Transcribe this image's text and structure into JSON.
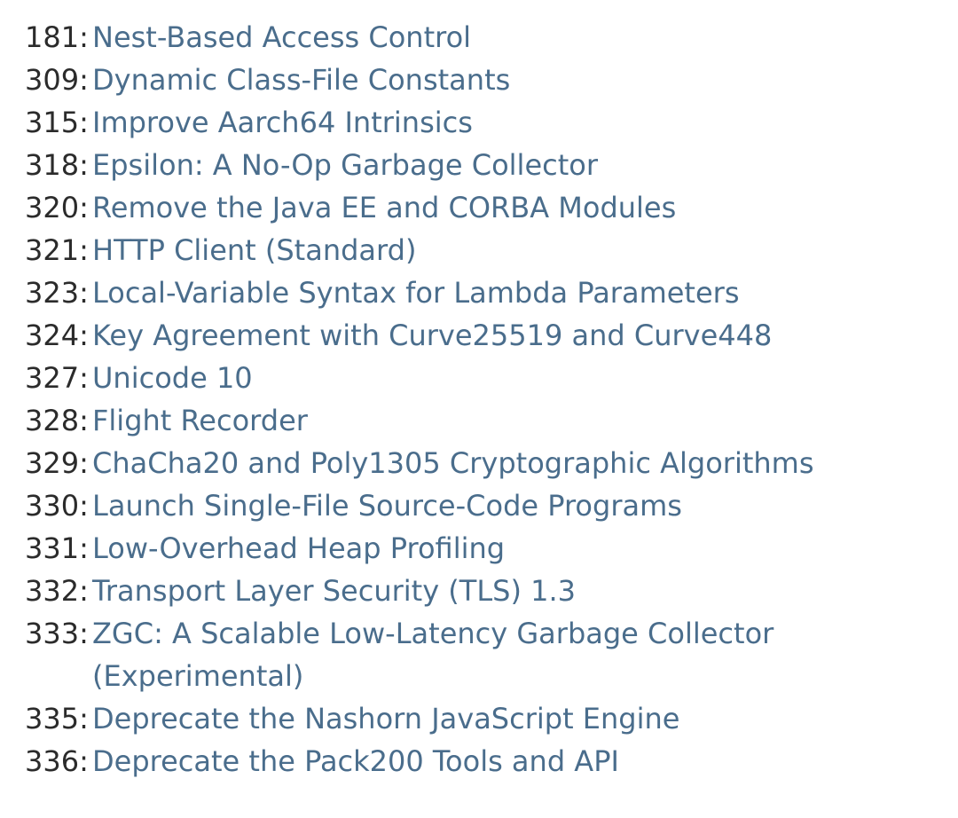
{
  "jeps": [
    {
      "id": "181",
      "title": "Nest-Based Access Control"
    },
    {
      "id": "309",
      "title": "Dynamic Class-File Constants"
    },
    {
      "id": "315",
      "title": "Improve Aarch64 Intrinsics"
    },
    {
      "id": "318",
      "title": "Epsilon: A No-Op Garbage Collector"
    },
    {
      "id": "320",
      "title": "Remove the Java EE and CORBA Modules"
    },
    {
      "id": "321",
      "title": "HTTP Client (Standard)"
    },
    {
      "id": "323",
      "title": "Local-Variable Syntax for Lambda Parameters"
    },
    {
      "id": "324",
      "title": "Key Agreement with Curve25519 and Curve448"
    },
    {
      "id": "327",
      "title": "Unicode 10"
    },
    {
      "id": "328",
      "title": "Flight Recorder"
    },
    {
      "id": "329",
      "title": "ChaCha20 and Poly1305 Cryptographic Algorithms"
    },
    {
      "id": "330",
      "title": "Launch Single-File Source-Code Programs"
    },
    {
      "id": "331",
      "title": "Low-Overhead Heap Profiling"
    },
    {
      "id": "332",
      "title": "Transport Layer Security (TLS) 1.3"
    },
    {
      "id": "333",
      "title": "ZGC: A Scalable Low-Latency Garbage Collector (Experimental)"
    },
    {
      "id": "335",
      "title": "Deprecate the Nashorn JavaScript Engine"
    },
    {
      "id": "336",
      "title": "Deprecate the Pack200 Tools and API"
    }
  ]
}
